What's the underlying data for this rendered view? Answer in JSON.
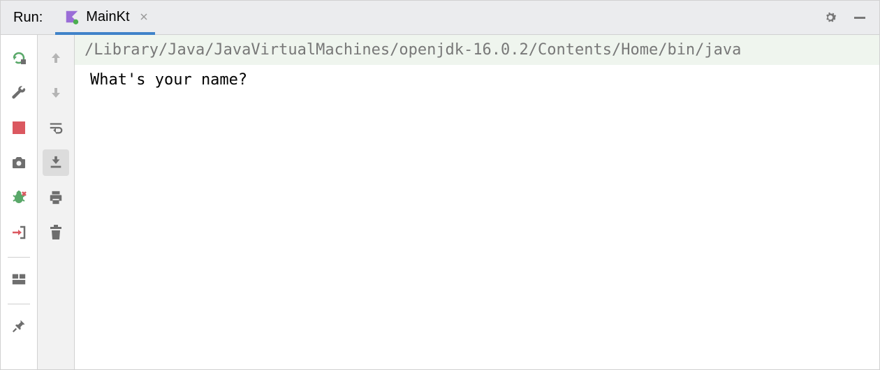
{
  "header": {
    "run_label": "Run:",
    "tab_label": "MainKt"
  },
  "console": {
    "command": "/Library/Java/JavaVirtualMachines/openjdk-16.0.2/Contents/Home/bin/java",
    "output": "What's your name?"
  }
}
